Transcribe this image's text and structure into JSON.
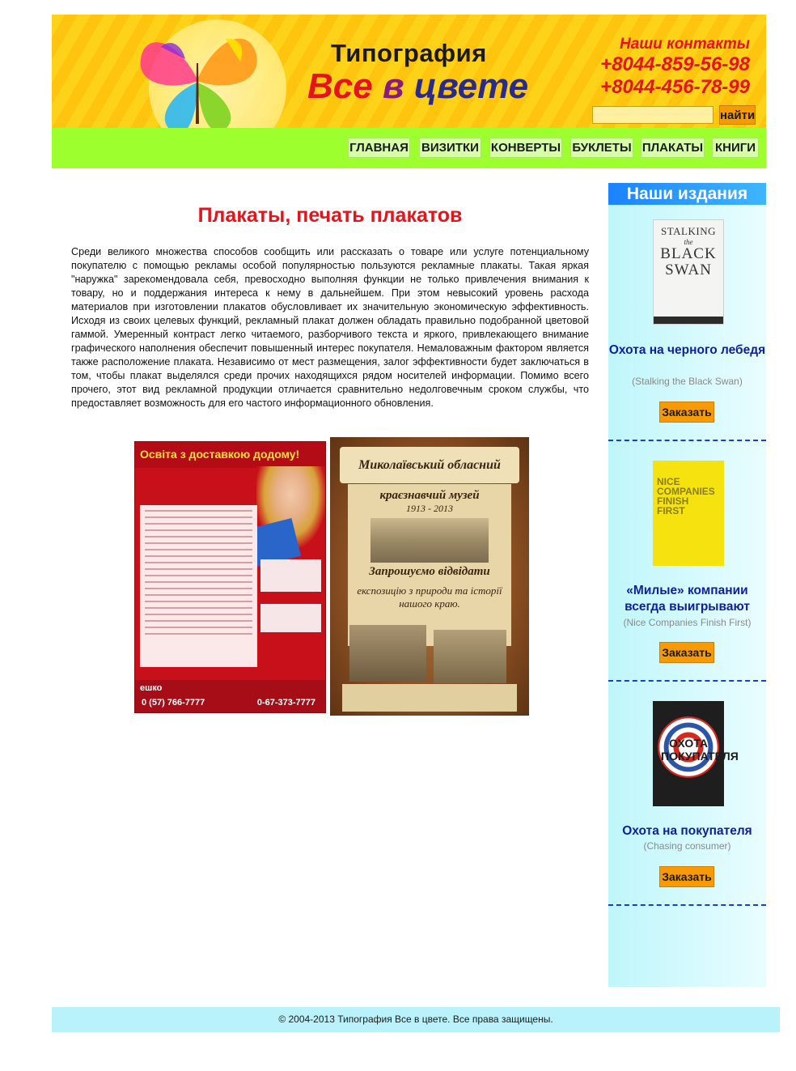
{
  "header": {
    "brand_line1": "Типография",
    "brand_line2_w1": "Все",
    "brand_line2_w2": "в",
    "brand_line2_w3": "цвете",
    "contacts_title": "Наши контакты",
    "phone1": "+8044-859-56-98",
    "phone2": "+8044-456-78-99",
    "search_placeholder": "",
    "search_button": "найти"
  },
  "nav": {
    "items": [
      {
        "label": "ГЛАВНАЯ"
      },
      {
        "label": "ВИЗИТКИ"
      },
      {
        "label": "КОНВЕРТЫ"
      },
      {
        "label": "БУКЛЕТЫ"
      },
      {
        "label": "ПЛАКАТЫ"
      },
      {
        "label": "КНИГИ"
      }
    ]
  },
  "main": {
    "title": "Плакаты, печать плакатов",
    "article": "Среди великого множества способов сообщить или рассказать о товаре или услуге потенциальному покупателю с помощью рекламы особой популярностью пользуются рекламные плакаты. Такая яркая \"наружка\" зарекомендовала себя, превосходно выполняя функции не только привлечения внимания к товару, но и поддержания интереса к нему в дальнейшем. При этом невысокий уровень расхода материалов при изготовлении плакатов обусловливает их значительную экономическую эффективность. Исходя из своих целевых функций, рекламный плакат должен обладать правильно подобранной цветовой гаммой. Умеренный контраст легко читаемого, разборчивого текста и яркого, привлекающего внимание графического наполнения обеспечит повышенный интерес покупателя. Немаловажным фактором является также расположение плаката. Независимо от мест размещения, залог эффективности будет заключаться в том, чтобы плакат выделялся среди прочих находящихся рядом носителей информации. Помимо всего прочего, этот вид рекламной продукции отличается сравнительно недолговечным сроком службы, что предоставляет возможность для его частого информационного обновления."
  },
  "posters": {
    "poster1": {
      "headline": "Освіта з доставкою додому!",
      "phone_left": "0 (57) 766-7777",
      "phone_right": "0-67-373-7777",
      "brand": "ешко"
    },
    "poster2": {
      "title": "Миколаївський обласний",
      "subtitle": "краєзнавчий музей",
      "years": "1913 - 2013",
      "invite": "Запрошуємо відвідати",
      "invite_sub": "експозицію з природи та історії нашого краю."
    }
  },
  "sidebar": {
    "title": "Наши издания",
    "books": [
      {
        "cover_lines": [
          "STALKING",
          "the",
          "BLACK",
          "SWAN"
        ],
        "title": "Охота на черного лебедя",
        "subtitle": "(Stalking the Black Swan)",
        "order_label": "Заказать"
      },
      {
        "cover_text": "NICE COMPANIES FINISH FIRST",
        "title": "«Милые» компании всегда выигрывают",
        "subtitle": "(Nice Companies Finish First)",
        "order_label": "Заказать"
      },
      {
        "cover_text": "ОХОТА ПОКУПАТЕЛЯ",
        "title": "Охота на покупателя",
        "subtitle": "(Chasing consumer)",
        "order_label": "Заказать"
      }
    ]
  },
  "footer": {
    "copyright": "© 2004-2013 Типография Все в цвете. Все права защищены."
  },
  "colors": {
    "header_yellow": "#ffd21a",
    "nav_green": "#9eff2e",
    "accent_red": "#e3141b",
    "sidebar_title_blue": "#1c82ff",
    "order_orange": "#f79a05",
    "footer_cyan": "#b9f2fb"
  }
}
